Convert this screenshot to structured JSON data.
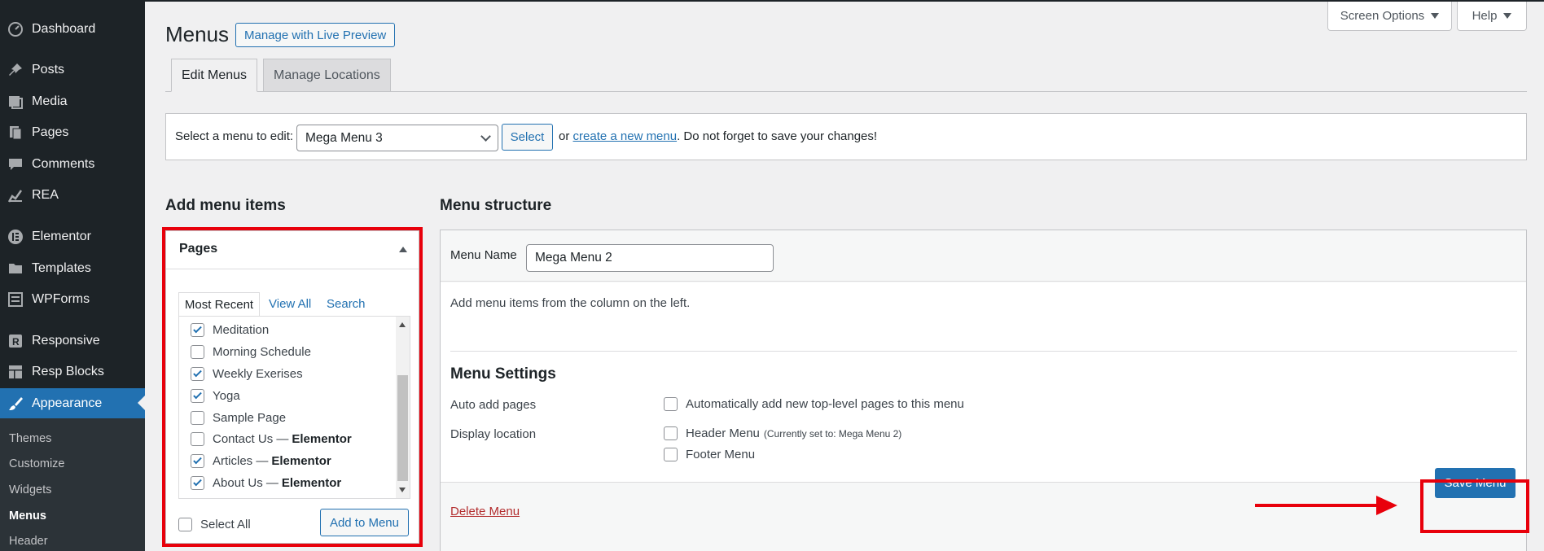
{
  "sidebar": {
    "items": [
      {
        "label": "Dashboard",
        "icon": "dashboard-icon"
      },
      {
        "label": "Posts",
        "icon": "pin-icon"
      },
      {
        "label": "Media",
        "icon": "media-icon"
      },
      {
        "label": "Pages",
        "icon": "pages-icon"
      },
      {
        "label": "Comments",
        "icon": "comment-icon"
      },
      {
        "label": "REA",
        "icon": "chart-icon"
      },
      {
        "label": "Elementor",
        "icon": "elementor-icon"
      },
      {
        "label": "Templates",
        "icon": "folder-icon"
      },
      {
        "label": "WPForms",
        "icon": "form-icon"
      },
      {
        "label": "Responsive",
        "icon": "responsive-icon"
      },
      {
        "label": "Resp Blocks",
        "icon": "blocks-icon"
      },
      {
        "label": "Appearance",
        "icon": "brush-icon"
      }
    ],
    "submenu": [
      "Themes",
      "Customize",
      "Widgets",
      "Menus",
      "Header"
    ]
  },
  "top": {
    "screen_options": "Screen Options",
    "help": "Help"
  },
  "header": {
    "title": "Menus",
    "live_preview": "Manage with Live Preview"
  },
  "tabs": {
    "edit": "Edit Menus",
    "locations": "Manage Locations"
  },
  "manage": {
    "label": "Select a menu to edit:",
    "selected": "Mega Menu 3",
    "select_button": "Select",
    "or": "or",
    "create_link": "create a new menu",
    "reminder": ". Do not forget to save your changes!"
  },
  "add_items": {
    "heading": "Add menu items",
    "panel_title": "Pages",
    "subtabs": [
      "Most Recent",
      "View All",
      "Search"
    ],
    "pages": [
      {
        "label": "Meditation",
        "suffix": "",
        "checked": true
      },
      {
        "label": "Morning Schedule",
        "suffix": "",
        "checked": false
      },
      {
        "label": "Weekly Exerises",
        "suffix": "",
        "checked": true
      },
      {
        "label": "Yoga",
        "suffix": "",
        "checked": true
      },
      {
        "label": "Sample Page",
        "suffix": "",
        "checked": false
      },
      {
        "label": "Contact Us —",
        "suffix": "Elementor",
        "checked": false
      },
      {
        "label": "Articles —",
        "suffix": "Elementor",
        "checked": true
      },
      {
        "label": "About Us —",
        "suffix": "Elementor",
        "checked": true
      }
    ],
    "select_all": "Select All",
    "add_button": "Add to Menu"
  },
  "structure": {
    "heading": "Menu structure",
    "name_label": "Menu Name",
    "name_value": "Mega Menu 2",
    "hint": "Add menu items from the column on the left.",
    "settings_title": "Menu Settings",
    "auto_add_label": "Auto add pages",
    "auto_add_option": "Automatically add new top-level pages to this menu",
    "display_label": "Display location",
    "header_menu": "Header Menu",
    "header_menu_note": "(Currently set to: Mega Menu 2)",
    "footer_menu": "Footer Menu",
    "delete": "Delete Menu",
    "save": "Save Menu"
  },
  "colors": {
    "accent": "#2271b1",
    "sidebar": "#1d2327",
    "annotation": "#e8000b"
  }
}
